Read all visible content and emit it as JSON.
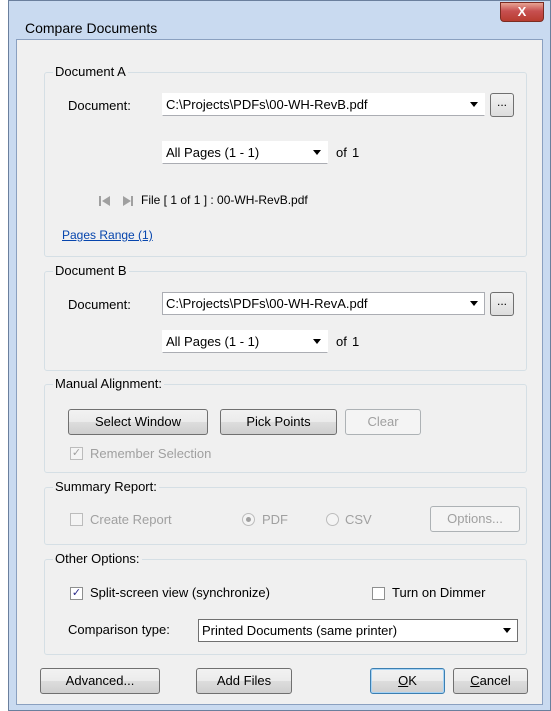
{
  "window": {
    "title": "Compare Documents",
    "close_label": "X"
  },
  "doc_a": {
    "group_label": "Document A",
    "document_label": "Document:",
    "document_value": "C:\\Projects\\PDFs\\00-WH-RevB.pdf",
    "browse_label": "...",
    "pages_value": "All Pages (1 - 1)",
    "of_label": "of",
    "page_count": "1",
    "file_info": "File [ 1 of 1 ] :  00-WH-RevB.pdf",
    "pages_range_link": "Pages Range (1)"
  },
  "doc_b": {
    "group_label": "Document B",
    "document_label": "Document:",
    "document_value": "C:\\Projects\\PDFs\\00-WH-RevA.pdf",
    "browse_label": "...",
    "pages_value": "All Pages (1 - 1)",
    "of_label": "of",
    "page_count": "1"
  },
  "manual_alignment": {
    "group_label": "Manual Alignment:",
    "select_window": "Select Window",
    "pick_points": "Pick Points",
    "clear": "Clear",
    "remember_selection": "Remember Selection"
  },
  "summary_report": {
    "group_label": "Summary Report:",
    "create_report": "Create Report",
    "pdf": "PDF",
    "csv": "CSV",
    "options": "Options..."
  },
  "other_options": {
    "group_label": "Other Options:",
    "split_screen": "Split-screen view (synchronize)",
    "dimmer": "Turn on Dimmer",
    "comparison_label": "Comparison type:",
    "comparison_value": "Printed Documents (same printer)"
  },
  "footer": {
    "advanced": "Advanced...",
    "add_files": "Add Files",
    "ok_key": "O",
    "ok_rest": "K",
    "cancel_key": "C",
    "cancel_rest": "ancel"
  },
  "colors": {
    "frame": "#c9daf0",
    "client": "#f0f0f0",
    "link": "#0645ad",
    "close": "#c75050"
  },
  "icons": [
    "first-page-icon",
    "next-page-icon",
    "dropdown-arrow-icon",
    "checkmark-icon"
  ]
}
